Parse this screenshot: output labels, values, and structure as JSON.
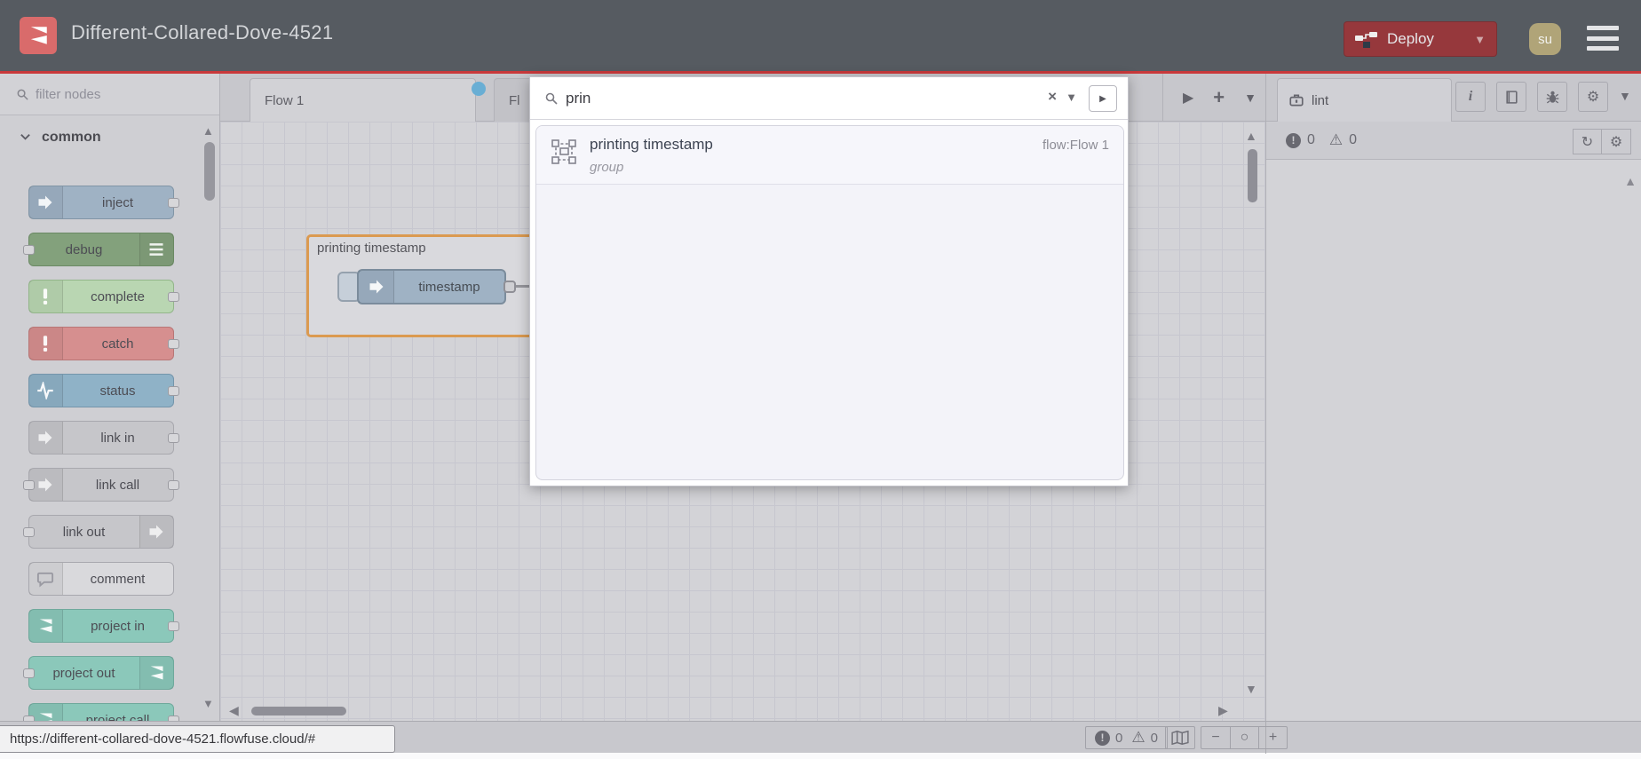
{
  "header": {
    "title": "Different-Collared-Dove-4521",
    "deploy_label": "Deploy",
    "avatar_text": "su",
    "bg_color": "#565b61",
    "accent_line_color": "#c9393b",
    "deploy_color": "#96383c"
  },
  "palette": {
    "filter_placeholder": "filter nodes",
    "category": "common",
    "nodes": [
      {
        "label": "inject",
        "icon": "inject-arrow",
        "icon_side": "left",
        "icon_color": "rgba(255,255,255,0.88)",
        "bg": "#9fb2c4",
        "border": "#8195a6",
        "port_left": false,
        "port_right": true
      },
      {
        "label": "debug",
        "icon": "debug-lines",
        "icon_side": "right",
        "icon_color": "rgba(255,255,255,0.88)",
        "bg": "#83a17c",
        "border": "#6b8a64",
        "port_left": true,
        "port_right": false
      },
      {
        "label": "complete",
        "icon": "exclamation",
        "icon_side": "left",
        "icon_color": "rgba(255,255,255,0.92)",
        "bg": "#b9d6b2",
        "border": "#93b68a",
        "port_left": false,
        "port_right": true
      },
      {
        "label": "catch",
        "icon": "exclamation",
        "icon_side": "left",
        "icon_color": "rgba(255,255,255,0.92)",
        "bg": "#d68f8f",
        "border": "#b87676",
        "port_left": false,
        "port_right": true
      },
      {
        "label": "status",
        "icon": "pulse",
        "icon_side": "left",
        "icon_color": "rgba(255,255,255,0.92)",
        "bg": "#8fb2c7",
        "border": "#7495ab",
        "port_left": false,
        "port_right": true
      },
      {
        "label": "link in",
        "icon": "link-arrow",
        "icon_side": "left",
        "icon_color": "rgba(255,255,255,0.75)",
        "bg": "#c6c6ca",
        "border": "#a8a8ae",
        "port_left": false,
        "port_right": true
      },
      {
        "label": "link call",
        "icon": "link-arrow",
        "icon_side": "left",
        "icon_color": "rgba(255,255,255,0.75)",
        "bg": "#c6c6ca",
        "border": "#a8a8ae",
        "port_left": true,
        "port_right": true
      },
      {
        "label": "link out",
        "icon": "link-arrow",
        "icon_side": "right",
        "icon_color": "rgba(255,255,255,0.75)",
        "bg": "#c6c6ca",
        "border": "#a8a8ae",
        "port_left": true,
        "port_right": false
      },
      {
        "label": "comment",
        "icon": "comment-bubble",
        "icon_side": "left",
        "icon_color": "#9a9aa2",
        "bg": "#d9d9dc",
        "border": "#a8a8ae",
        "port_left": false,
        "port_right": false
      },
      {
        "label": "project in",
        "icon": "ff-logo",
        "icon_side": "left",
        "icon_color": "rgba(255,255,255,0.92)",
        "bg": "#8bc8ba",
        "border": "#6fa99c",
        "port_left": false,
        "port_right": true
      },
      {
        "label": "project out",
        "icon": "ff-logo",
        "icon_side": "right",
        "icon_color": "rgba(255,255,255,0.92)",
        "bg": "#8bc8ba",
        "border": "#6fa99c",
        "port_left": true,
        "port_right": false
      },
      {
        "label": "project call",
        "icon": "ff-logo",
        "icon_side": "left",
        "icon_color": "rgba(255,255,255,0.92)",
        "bg": "#8bc8ba",
        "border": "#6fa99c",
        "port_left": true,
        "port_right": true
      }
    ]
  },
  "workspace": {
    "tabs": [
      {
        "label": "Flow 1"
      },
      {
        "label": "Fl"
      }
    ],
    "group_label": "printing timestamp",
    "node_label": "timestamp",
    "group_highlight_color": "#db9a50",
    "unsaved_dot_color": "#69aed4"
  },
  "search": {
    "query": "prin",
    "result": {
      "title": "printing timestamp",
      "meta": "flow:Flow 1",
      "type": "group"
    }
  },
  "sidebar": {
    "tab_label": "lint",
    "error_count": "0",
    "warning_count": "0"
  },
  "canvas_footer": {
    "error_count": "0",
    "warning_count": "0",
    "zoom_out": "−",
    "zoom_reset": "○",
    "zoom_in": "+"
  },
  "status": {
    "url": "https://different-collared-dove-4521.flowfuse.cloud/#"
  }
}
